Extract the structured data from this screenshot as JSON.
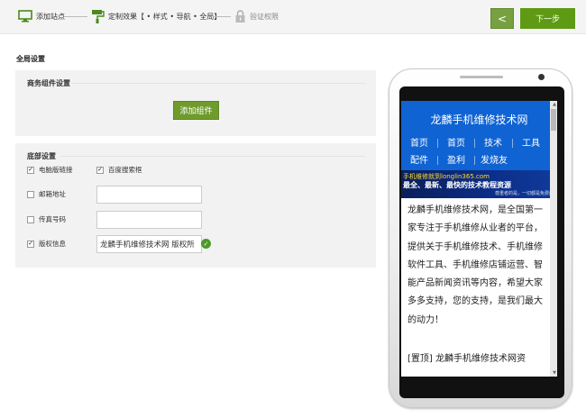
{
  "steps": [
    {
      "label": "添加站点",
      "icon": "monitor-icon"
    },
    {
      "label": "定制效果【 • 样式 • 导航 • 全局】",
      "icon": "paint-roller-icon"
    },
    {
      "label": "验证权限",
      "icon": "lock-icon"
    }
  ],
  "toolbar": {
    "back_glyph": "<",
    "next_label": "下一步"
  },
  "settings": {
    "title": "全局设置",
    "biz": {
      "title": "商务组件设置",
      "add_label": "添加组件"
    },
    "footer": {
      "title": "底部设置",
      "check_pc": "电脑版链接",
      "check_baidu": "百度搜索框",
      "email_label": "邮箱地址",
      "email_value": "",
      "fax_label": "传真号码",
      "fax_value": "",
      "copyright_label": "版权信息",
      "copyright_value": "龙麟手机维修技术网 版权所"
    }
  },
  "preview": {
    "site_title": "龙麟手机维修技术网",
    "nav": [
      "首页",
      "首页",
      "技术",
      "工具",
      "配件",
      "盈利",
      "发烧友"
    ],
    "banner_line1": "手机维修就到longlin365.com",
    "banner_line2": "最全、最新、最快的技术教程资源",
    "banner_line3": "尊重者的是，一切都是免费的",
    "article": "龙麟手机维修技术网，是全国第一家专注于手机维修从业者的平台，提供关于手机维修技术、手机维修软件工具、手机维修店铺运营、智能产品新闻资讯等内容，希望大家多多支持，您的支持，是我们最大的动力！",
    "top_item": "[置顶] 龙麟手机维修技术网资"
  },
  "colors": {
    "accent_green": "#5f9a14",
    "site_blue": "#0f63d3"
  }
}
